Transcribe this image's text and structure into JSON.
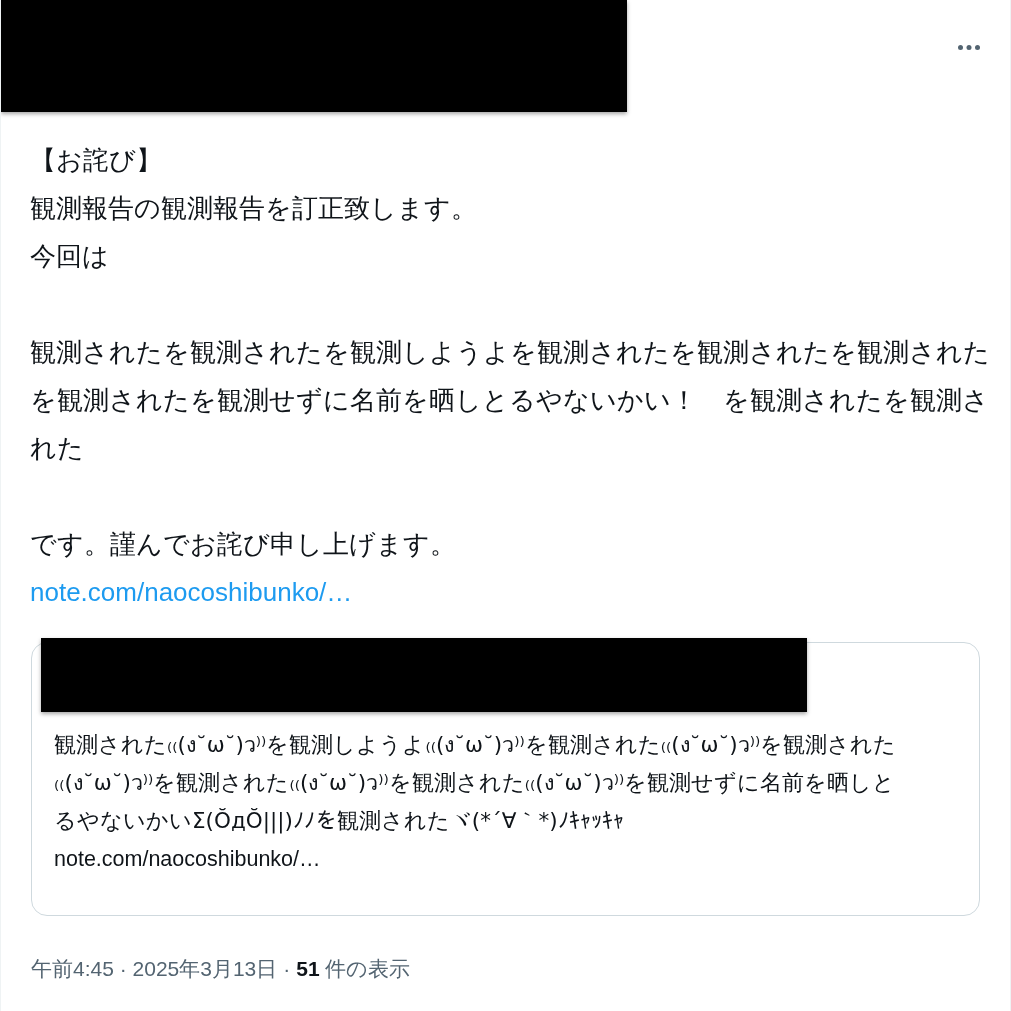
{
  "post": {
    "paragraphs": [
      [
        "【お詫び】",
        "観測報告の観測報告を訂正致します。",
        "今回は"
      ],
      [
        "観測されたを観測されたを観測しようよを観測されたを観測されたを観測されたを観測されたを観測せずに名前を晒しとるやないかい！　を観測されたを観測された"
      ],
      [
        "です。謹んでお詫び申し上げます。"
      ]
    ],
    "link": "note.com/naocoshibunko/…"
  },
  "quote": {
    "text": "観測された₍₍(ง˘ω˘)ว⁾⁾を観測しようよ₍₍(ง˘ω˘)ว⁾⁾を観測された₍₍(ง˘ω˘)ว⁾⁾を観測された₍₍(ง˘ω˘)ว⁾⁾を観測された₍₍(ง˘ω˘)ว⁾⁾を観測された₍₍(ง˘ω˘)ว⁾⁾を観測せずに名前を晒しとるやないかいΣ(ŎдŎ|||)ﾉﾉを観測されたヾ(*´∀｀*)ﾉｷｬｯｷｬ",
    "link": "note.com/naocoshibunko/…"
  },
  "meta": {
    "timestamp": "午前4:45 · 2025年3月13日",
    "separator": "·",
    "views": "**51** 件の表示"
  }
}
